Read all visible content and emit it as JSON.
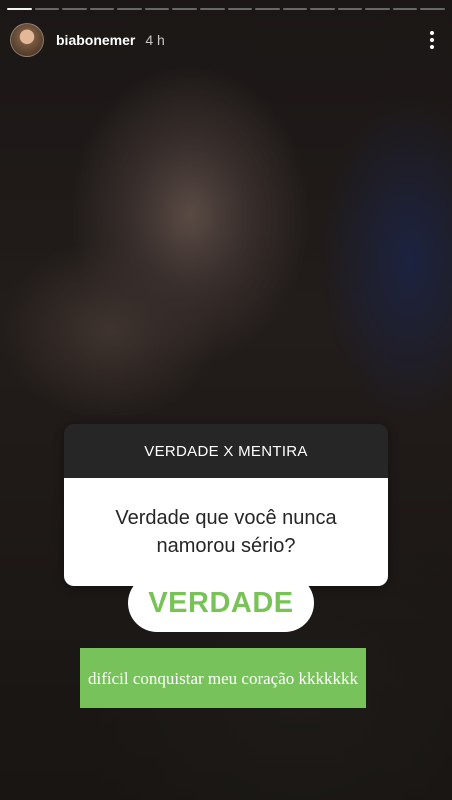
{
  "story": {
    "progress_segments": 16,
    "progress_done": 1,
    "username": "biabonemer",
    "time_ago": "4 h",
    "more_icon": "more-vertical-icon"
  },
  "question_sticker": {
    "header": "VERDADE X MENTIRA",
    "question": "Verdade que você nunca namorou sério?"
  },
  "answer": {
    "label": "VERDADE",
    "color": "#78c257"
  },
  "caption": {
    "text": "difícil conquistar meu coração kkkkkkk",
    "background": "#77c25a"
  }
}
